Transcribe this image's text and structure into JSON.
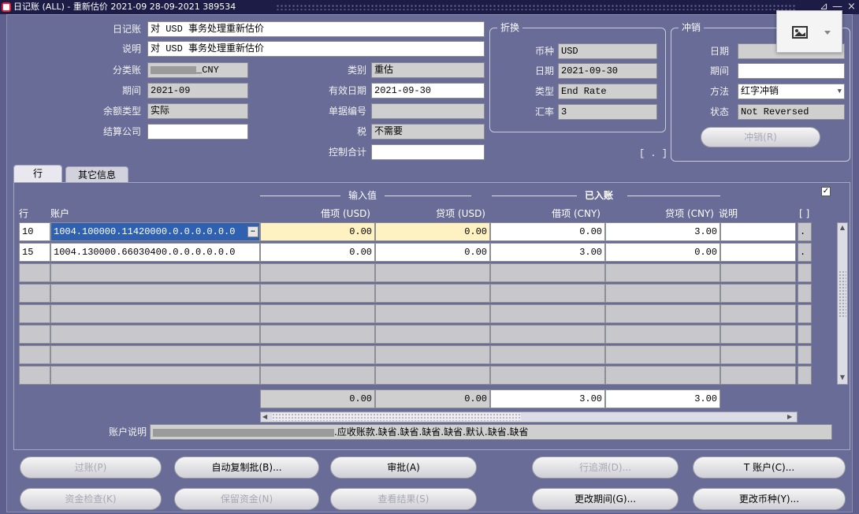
{
  "window": {
    "title": "日记账 (ALL) - 重新估价 2021-09 28-09-2021 389534",
    "controls": [
      "⊿",
      "—",
      "×"
    ]
  },
  "header": {
    "journal_label": "日记账",
    "journal_value": "对 USD 事务处理重新估价",
    "desc_label": "说明",
    "desc_value": "对 USD 事务处理重新估价",
    "ledger_label": "分类账",
    "ledger_value": "_CNY",
    "period_label": "期间",
    "period_value": "2021-09",
    "balance_type_label": "余额类型",
    "balance_type_value": "实际",
    "clearing_company_label": "结算公司",
    "clearing_company_value": "",
    "category_label": "类别",
    "category_value": "重估",
    "effective_date_label": "有效日期",
    "effective_date_value": "2021-09-30",
    "doc_number_label": "单据编号",
    "doc_number_value": "",
    "tax_label": "税",
    "tax_value": "不需要",
    "control_total_label": "控制合计",
    "control_total_value": "",
    "bracket": "[ . ]"
  },
  "conversion": {
    "title": "折换",
    "currency_label": "币种",
    "currency_value": "USD",
    "date_label": "日期",
    "date_value": "2021-09-30",
    "type_label": "类型",
    "type_value": "End Rate",
    "rate_label": "汇率",
    "rate_value": "3"
  },
  "reverse": {
    "title": "冲销",
    "date_label": "日期",
    "date_value": "",
    "period_label": "期间",
    "period_value": "",
    "method_label": "方法",
    "method_value": "红字冲销",
    "status_label": "状态",
    "status_value": "Not Reversed",
    "button": "冲销(R)"
  },
  "tabs": [
    {
      "label": "行"
    },
    {
      "label": "其它信息"
    }
  ],
  "lines": {
    "group_entered": "输入值",
    "group_accounted": "已入账",
    "headers": {
      "line": "行",
      "account": "账户",
      "debit_usd": "借项 (USD)",
      "credit_usd": "贷项 (USD)",
      "debit_cny": "借项 (CNY)",
      "credit_cny": "贷项 (CNY)",
      "description": "说明",
      "flex": "[ ]"
    },
    "rows": [
      {
        "line": "10",
        "account": "1004.100000.11420000.0.0.0.0.0.0",
        "debit_usd": "0.00",
        "credit_usd": "0.00",
        "debit_cny": "0.00",
        "credit_cny": "3.00",
        "description": "",
        "flex": "."
      },
      {
        "line": "15",
        "account": "1004.130000.66030400.0.0.0.0.0.0",
        "debit_usd": "0.00",
        "credit_usd": "0.00",
        "debit_cny": "3.00",
        "credit_cny": "0.00",
        "description": "",
        "flex": "."
      }
    ],
    "totals": {
      "debit_usd": "0.00",
      "credit_usd": "0.00",
      "debit_cny": "3.00",
      "credit_cny": "3.00"
    },
    "account_desc_label": "账户说明",
    "account_desc_value": ".应收账款.缺省.缺省.缺省.缺省.默认.缺省.缺省",
    "checkbox_mark": "✓"
  },
  "buttons": {
    "post": "过账(P)",
    "autocopy": "自动复制批(B)...",
    "approve": "审批(A)",
    "drilldown": "行追溯(D)...",
    "t_account": "T 账户(C)...",
    "funds_check": "资金检查(K)",
    "reserve_funds": "保留资金(N)",
    "view_results": "查看结果(S)",
    "change_period": "更改期间(G)...",
    "change_currency": "更改币种(Y)..."
  },
  "colors": {
    "background": "#686c96",
    "titlebar": "#1c1c46",
    "selected": "#3060b0",
    "entered_highlight": "#fff2c2"
  }
}
